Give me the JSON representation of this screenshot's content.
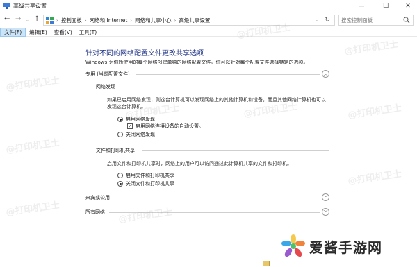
{
  "window": {
    "title": "高级共享设置",
    "minimize_glyph": "—",
    "maximize_glyph": "☐",
    "close_glyph": "✕"
  },
  "nav": {
    "back_glyph": "←",
    "forward_glyph": "→",
    "recent_glyph": "⌄",
    "up_glyph": "↑"
  },
  "address": {
    "crumbs": [
      "控制面板",
      "网络和 Internet",
      "网络和共享中心",
      "高级共享设置"
    ],
    "separator": "›",
    "dropdown_glyph": "⌄",
    "refresh_glyph": "↻"
  },
  "search": {
    "placeholder": "搜索控制面板"
  },
  "menu": {
    "items": [
      "文件(F)",
      "编辑(E)",
      "查看(V)",
      "工具(T)"
    ]
  },
  "content": {
    "heading": "针对不同的网络配置文件更改共享选项",
    "subtitle": "Windows 为你所使用的每个网络创建单独的网络配置文件。你可以针对每个配置文件选择特定的选项。",
    "private_profile": {
      "label": "专用 (当前配置文件)",
      "toggle_glyph": "︿",
      "network_discovery": {
        "label": "网络发现",
        "description": "如果已启用网络发现，则这台计算机可以发现网络上的其他计算机和设备，而且其他网络计算机也可以发现这台计算机。",
        "option_on": "启用网络发现",
        "option_auto": "启用网络连接设备的自动设置。",
        "option_off": "关闭网络发现",
        "check_glyph": "✓"
      },
      "file_printer_sharing": {
        "label": "文件和打印机共享",
        "description": "启用文件和打印机共享时，网络上的用户可以访问通过此计算机共享的文件和打印机。",
        "option_on": "启用文件和打印机共享",
        "option_off": "关闭文件和打印机共享"
      }
    },
    "guest_public": {
      "label": "来宾或公用",
      "toggle_glyph": "﹀"
    },
    "all_networks": {
      "label": "所有网络",
      "toggle_glyph": "﹀"
    }
  },
  "watermark": "@打印机卫士",
  "logo_text": "爱酱手游网",
  "colors": {
    "heading": "#1e3287",
    "menu_active_bg": "#cce4f7"
  }
}
